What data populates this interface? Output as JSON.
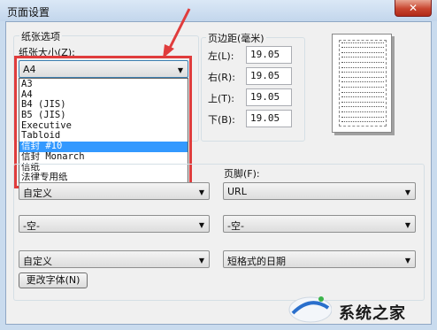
{
  "window": {
    "title": "页面设置",
    "close_glyph": "✕"
  },
  "paper_group": {
    "legend": "纸张选项",
    "size_label": "纸张大小(Z):",
    "selected": "A4",
    "options": [
      "A3",
      "A4",
      "B4 (JIS)",
      "B5 (JIS)",
      "Executive",
      "Tabloid",
      "信封 #10",
      "信封 Monarch",
      "信纸",
      "法律专用纸"
    ],
    "highlighted": "信封 #10"
  },
  "margins": {
    "legend": "页边距(毫米)",
    "left_label": "左(L):",
    "left": "19.05",
    "right_label": "右(R):",
    "right": "19.05",
    "top_label": "上(T):",
    "top": "19.05",
    "bottom_label": "下(B):",
    "bottom": "19.05"
  },
  "header_footer": {
    "footer_label": "页脚(F):",
    "left_combos": [
      "自定义",
      "-空-",
      "自定义"
    ],
    "right_combos": [
      "URL",
      "-空-",
      "短格式的日期"
    ],
    "change_font_button": "更改字体(N)"
  },
  "watermark": {
    "text": "系统之家"
  },
  "colors": {
    "annotation_red": "#e03c3c",
    "selection_blue": "#3399ff"
  }
}
